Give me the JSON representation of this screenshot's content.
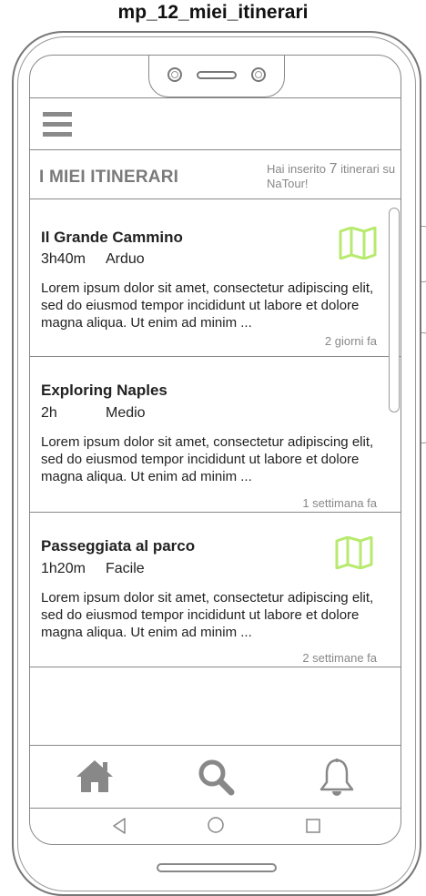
{
  "frame_title": "mp_12_miei_itinerari",
  "header": {
    "menu_icon": "hamburger-menu-icon",
    "page_title": "I MIEI ITINERARI",
    "summary_prefix": "Hai inserito ",
    "summary_count": "7",
    "summary_suffix": " itinerari su NaTour!"
  },
  "itineraries": [
    {
      "title": "Il Grande Cammino",
      "duration": "3h40m",
      "difficulty": "Arduo",
      "description": "Lorem ipsum dolor sit amet, consectetur adipiscing elit, sed do eiusmod tempor incididunt ut labore et dolore magna aliqua. Ut enim ad minim ...",
      "time_ago": "2 giorni fa",
      "has_map": true
    },
    {
      "title": "Exploring Naples",
      "duration": "2h",
      "difficulty": "Medio",
      "description": "Lorem ipsum dolor sit amet, consectetur adipiscing elit, sed do eiusmod tempor incididunt ut labore et dolore magna aliqua. Ut enim ad minim ...",
      "time_ago": "1 settimana fa",
      "has_map": false
    },
    {
      "title": "Passeggiata al parco",
      "duration": "1h20m",
      "difficulty": "Facile",
      "description": "Lorem ipsum dolor sit amet, consectetur adipiscing elit, sed do eiusmod tempor incididunt ut labore et dolore magna aliqua. Ut enim ad minim ...",
      "time_ago": "2 settimane fa",
      "has_map": true
    }
  ],
  "tab_bar": [
    "home-icon",
    "search-icon",
    "bell-icon"
  ],
  "system_nav": [
    "back-icon",
    "home-circle-icon",
    "recents-square-icon"
  ],
  "colors": {
    "map_icon": "#b7ea6e",
    "tab_icon": "#888888",
    "muted_text": "#888888"
  }
}
